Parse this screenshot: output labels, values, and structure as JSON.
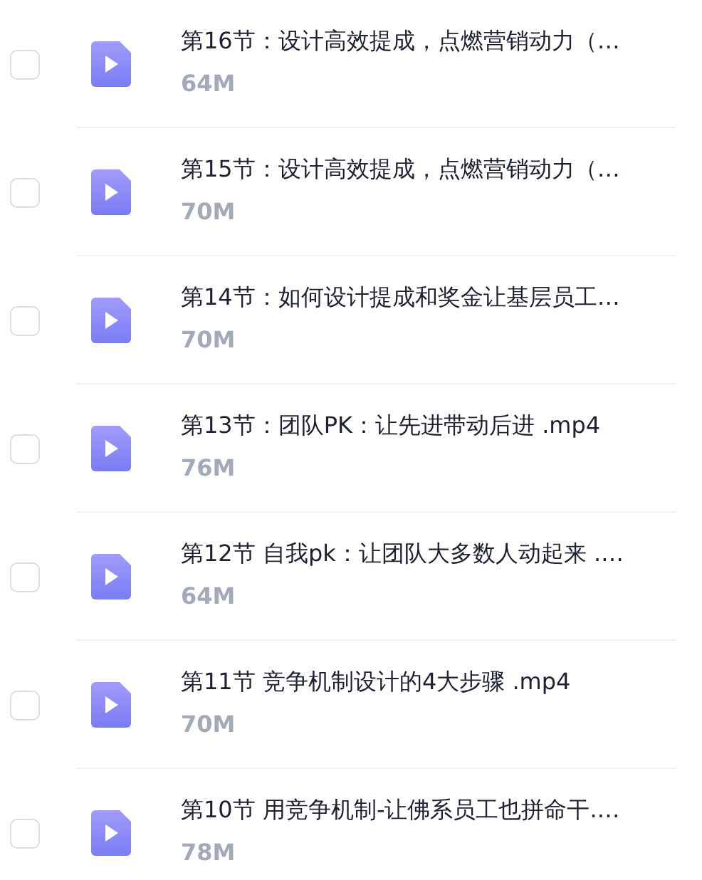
{
  "files": [
    {
      "title": "第16节：设计高效提成，点燃营销动力（…",
      "size": "64M",
      "checked": false
    },
    {
      "title": "第15节：设计高效提成，点燃营销动力（…",
      "size": "70M",
      "checked": false
    },
    {
      "title": "第14节：如何设计提成和奖金让基层员工…",
      "size": "70M",
      "checked": false
    },
    {
      "title": "第13节：团队PK：让先进带动后进 .mp4",
      "size": "76M",
      "checked": false
    },
    {
      "title": "第12节 自我pk：让团队大多数人动起来 .…",
      "size": "64M",
      "checked": false
    },
    {
      "title": "第11节 竞争机制设计的4大步骤 .mp4",
      "size": "70M",
      "checked": false
    },
    {
      "title": "第10节 用竞争机制-让佛系员工也拼命干.…",
      "size": "78M",
      "checked": false
    }
  ]
}
